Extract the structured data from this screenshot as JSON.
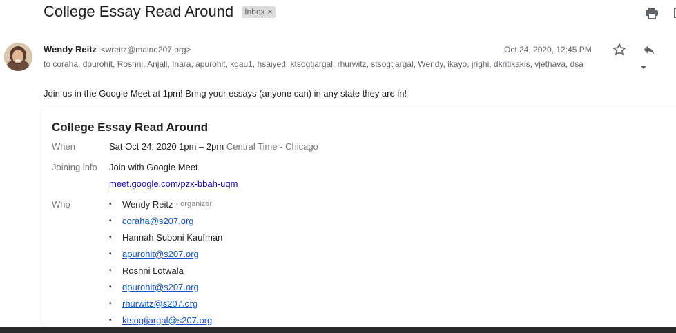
{
  "email": {
    "subject": "College Essay Read Around",
    "label": "Inbox",
    "label_close": "×",
    "sender": {
      "name": "Wendy Reitz",
      "email": "<wreitz@maine207.org>"
    },
    "date": "Oct 24, 2020, 12:45 PM",
    "recipients": "to coraha, dpurohit, Roshni, Anjali, Inara, apurohit, kgau1, hsaiyed, ktsogtjargal, rhurwitz, stsogtjargal, Wendy, ikayo, jrighi, dkritikakis, vjethava, dsa",
    "body": "Join us in the Google Meet at 1pm! Bring your essays (anyone can) in any state they are in!"
  },
  "invite": {
    "title": "College Essay Read Around",
    "when_label": "When",
    "when_value": "Sat Oct 24, 2020 1pm – 2pm",
    "timezone": "Central Time - Chicago",
    "joining_label": "Joining info",
    "join_text": "Join with Google Meet",
    "meet_link": "meet.google.com/pzx-bbah-uqm",
    "who_label": "Who",
    "organizer_tag": "- organizer",
    "guests": [
      {
        "name": "Wendy Reitz",
        "is_link": false
      },
      {
        "name": "coraha@s207.org",
        "is_link": true
      },
      {
        "name": "Hannah Suboni Kaufman",
        "is_link": false
      },
      {
        "name": "apurohit@s207.org",
        "is_link": true
      },
      {
        "name": "Roshni Lotwala",
        "is_link": false
      },
      {
        "name": "dpurohit@s207.org",
        "is_link": true
      },
      {
        "name": "rhurwitz@s207.org",
        "is_link": true
      },
      {
        "name": "ktsogtjargal@s207.org",
        "is_link": true
      }
    ]
  },
  "icons": {
    "print": "print-icon",
    "new_window": "new-window-icon",
    "star": "star-icon",
    "reply": "reply-icon",
    "caret": "chevron-down-icon"
  }
}
